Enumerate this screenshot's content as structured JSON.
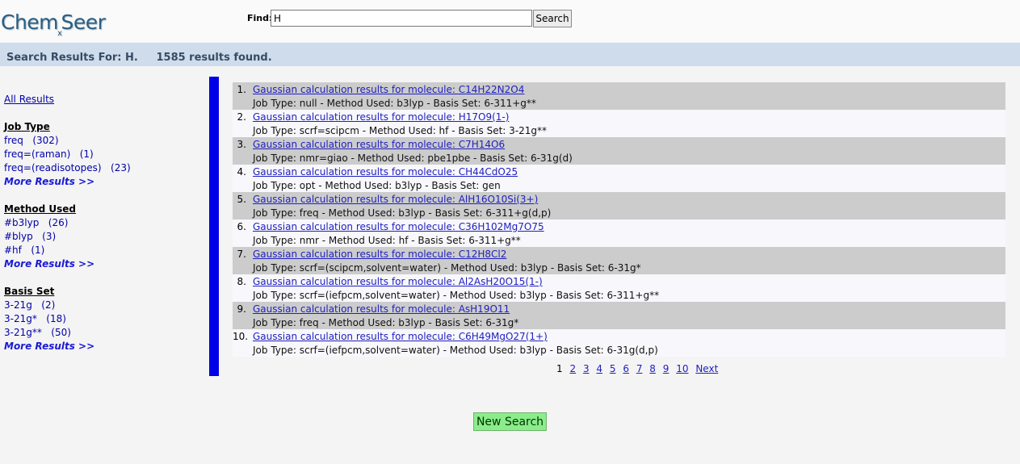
{
  "header": {
    "logo_left": "Chem",
    "logo_x": "x",
    "logo_right": "Seer",
    "find_label": "Find:",
    "search_value": "H",
    "search_button": "Search"
  },
  "summary": {
    "text": "Search Results For: H.     1585 results found."
  },
  "sidebar": {
    "all_results": "All Results",
    "facets": [
      {
        "title": "Job Type",
        "items": [
          "freq   (302)",
          "freq=(raman)   (1)",
          "freq=(readisotopes)   (23)"
        ],
        "more": "More Results >>"
      },
      {
        "title": "Method Used",
        "items": [
          "#b3lyp   (26)",
          "#blyp   (3)",
          "#hf   (1)"
        ],
        "more": "More Results >>"
      },
      {
        "title": "Basis Set",
        "items": [
          "3-21g   (2)",
          "3-21g*   (18)",
          "3-21g**   (50)"
        ],
        "more": "More Results >>"
      }
    ]
  },
  "results": [
    {
      "num": "1.",
      "title": "Gaussian calculation results for molecule: C14H22N2O4",
      "desc": "Job Type: null - Method Used: b3lyp - Basis Set: 6-311+g**"
    },
    {
      "num": "2.",
      "title": "Gaussian calculation results for molecule: H17O9(1-)",
      "desc": "Job Type: scrf=scipcm - Method Used: hf - Basis Set: 3-21g**"
    },
    {
      "num": "3.",
      "title": "Gaussian calculation results for molecule: C7H14O6",
      "desc": "Job Type: nmr=giao - Method Used: pbe1pbe - Basis Set: 6-31g(d)"
    },
    {
      "num": "4.",
      "title": "Gaussian calculation results for molecule: CH44CdO25",
      "desc": "Job Type: opt - Method Used: b3lyp - Basis Set: gen"
    },
    {
      "num": "5.",
      "title": "Gaussian calculation results for molecule: AlH16O10Si(3+)",
      "desc": "Job Type: freq - Method Used: b3lyp - Basis Set: 6-311+g(d,p)"
    },
    {
      "num": "6.",
      "title": "Gaussian calculation results for molecule: C36H102Mg7O75",
      "desc": "Job Type: nmr - Method Used: hf - Basis Set: 6-311+g**"
    },
    {
      "num": "7.",
      "title": "Gaussian calculation results for molecule: C12H8Cl2",
      "desc": "Job Type: scrf=(scipcm,solvent=water) - Method Used: b3lyp - Basis Set: 6-31g*"
    },
    {
      "num": "8.",
      "title": "Gaussian calculation results for molecule: Al2AsH20O15(1-)",
      "desc": "Job Type: scrf=(iefpcm,solvent=water) - Method Used: b3lyp - Basis Set: 6-311+g**"
    },
    {
      "num": "9.",
      "title": "Gaussian calculation results for molecule: AsH19O11",
      "desc": "Job Type: freq - Method Used: b3lyp - Basis Set: 6-31g*"
    },
    {
      "num": "10.",
      "title": "Gaussian calculation results for molecule: C6H49MgO27(1+)",
      "desc": "Job Type: scrf=(iefpcm,solvent=water) - Method Used: b3lyp - Basis Set: 6-31g(d,p)"
    }
  ],
  "pagination": {
    "current": "1",
    "pages": [
      "2",
      "3",
      "4",
      "5",
      "6",
      "7",
      "8",
      "9",
      "10"
    ],
    "next": "Next"
  },
  "new_search": "New Search",
  "colors": {
    "accent_bar": "#0000e6",
    "summary_bg": "#cfdceb",
    "new_search_bg": "#8aed8a",
    "link": "#2020c0"
  }
}
